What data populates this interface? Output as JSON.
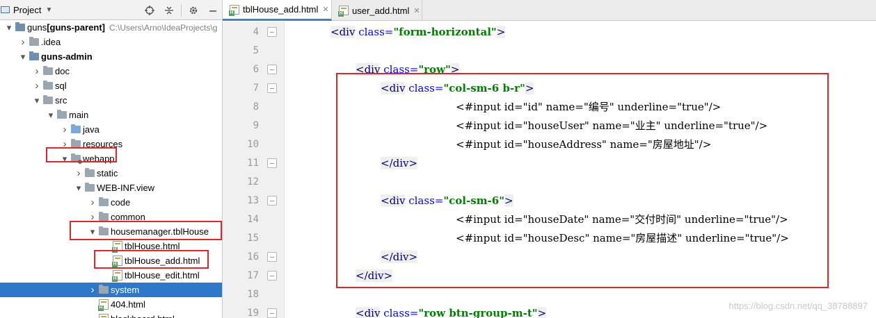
{
  "project_panel": {
    "title": "Project",
    "tools": [
      "target-icon",
      "collapse-icon",
      "gear-icon",
      "minimize-icon"
    ],
    "tree": [
      {
        "label": "guns",
        "extra": " [guns-parent]",
        "path": "C:\\Users\\Arno\\IdeaProjects\\g",
        "indent": 0,
        "arrow": "▾",
        "icon": "module",
        "bold": false
      },
      {
        "label": ".idea",
        "indent": 1,
        "arrow": "›",
        "icon": "folder"
      },
      {
        "label": "guns-admin",
        "indent": 1,
        "arrow": "▾",
        "icon": "module",
        "bold": true
      },
      {
        "label": "doc",
        "indent": 2,
        "arrow": "›",
        "icon": "folder"
      },
      {
        "label": "sql",
        "indent": 2,
        "arrow": "›",
        "icon": "folder"
      },
      {
        "label": "src",
        "indent": 2,
        "arrow": "▾",
        "icon": "folder"
      },
      {
        "label": "main",
        "indent": 3,
        "arrow": "▾",
        "icon": "folder"
      },
      {
        "label": "java",
        "indent": 4,
        "arrow": "›",
        "icon": "folder-blue"
      },
      {
        "label": "resources",
        "indent": 4,
        "arrow": "›",
        "icon": "folder"
      },
      {
        "label": "webapp",
        "indent": 4,
        "arrow": "▾",
        "icon": "folder-dot"
      },
      {
        "label": "static",
        "indent": 5,
        "arrow": "›",
        "icon": "folder"
      },
      {
        "label": "WEB-INF.view",
        "indent": 5,
        "arrow": "▾",
        "icon": "folder"
      },
      {
        "label": "code",
        "indent": 6,
        "arrow": "›",
        "icon": "folder"
      },
      {
        "label": "common",
        "indent": 6,
        "arrow": "›",
        "icon": "folder"
      },
      {
        "label": "housemanager.tblHouse",
        "indent": 6,
        "arrow": "▾",
        "icon": "folder"
      },
      {
        "label": "tblHouse.html",
        "indent": 7,
        "arrow": "",
        "icon": "html"
      },
      {
        "label": "tblHouse_add.html",
        "indent": 7,
        "arrow": "",
        "icon": "html"
      },
      {
        "label": "tblHouse_edit.html",
        "indent": 7,
        "arrow": "",
        "icon": "html"
      },
      {
        "label": "system",
        "indent": 6,
        "arrow": "›",
        "icon": "folder",
        "selected": true
      },
      {
        "label": "404.html",
        "indent": 6,
        "arrow": "",
        "icon": "html"
      },
      {
        "label": "blackboard.html",
        "indent": 6,
        "arrow": "",
        "icon": "html"
      }
    ]
  },
  "editor": {
    "tabs": [
      {
        "label": "tblHouse_add.html",
        "active": true
      },
      {
        "label": "user_add.html",
        "active": false
      }
    ],
    "line_numbers": [
      "4",
      "5",
      "6",
      "7",
      "8",
      "9",
      "10",
      "11",
      "12",
      "13",
      "14",
      "15",
      "16",
      "17",
      "18",
      "19"
    ],
    "lines": [
      "<div class=\"form-horizontal\">",
      "",
      "<div class=\"row\">",
      "<div class=\"col-sm-6 b-r\">",
      "<#input id=\"id\" name=\"编号\" underline=\"true\"/>",
      "<#input id=\"houseUser\" name=\"业主\" underline=\"true\"/>",
      "<#input id=\"houseAddress\" name=\"房屋地址\"/>",
      "</div>",
      "",
      "<div class=\"col-sm-6\">",
      "<#input id=\"houseDate\" name=\"交付时间\" underline=\"true\"/>",
      "<#input id=\"houseDesc\" name=\"房屋描述\" underline=\"true\"/>",
      "</div>",
      "</div>",
      "",
      "<div class=\"row btn-group-m-t\">"
    ]
  },
  "watermark": "https://blog.csdn.net/qq_38788897",
  "colors": {
    "selection": "#2d78c8",
    "highlight_box": "#e0262c",
    "tag": "#000080",
    "attr": "#0000ff",
    "value": "#008000"
  }
}
